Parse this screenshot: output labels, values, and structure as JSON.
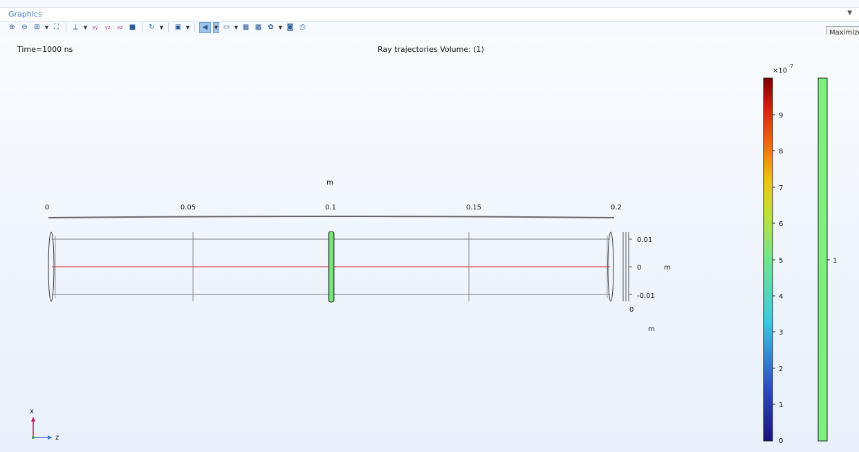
{
  "window": {
    "title": "Graphics",
    "tooltip": "Maximize"
  },
  "toolbar": {
    "icons": [
      "zoom-in-icon",
      "zoom-out-icon",
      "zoom-box-icon",
      "zoom-extents-icon",
      "axis-orientation-icon",
      "xy-view-icon",
      "yz-view-icon",
      "xz-view-icon",
      "camera-view-icon",
      "rotate-icon",
      "render-mode-icon",
      "light-icon",
      "wireframe-icon",
      "grid-icon",
      "transparency-icon",
      "image-snapshot-icon",
      "print-icon"
    ]
  },
  "plot": {
    "time_label": "Time=1000 ns",
    "title": "Ray trajectories  Volume: (1)",
    "top_axis": {
      "unit": "m",
      "ticks": [
        "0",
        "0.05",
        "0.1",
        "0.15",
        "0.2"
      ]
    },
    "side_axis": {
      "unit": "m",
      "ticks": [
        "0.01",
        "0",
        "-0.01"
      ]
    },
    "depth_axis": {
      "tick": "0",
      "unit": "m"
    },
    "axis_triad": {
      "vertical": "x",
      "horizontal": "z"
    }
  },
  "colorbars": {
    "left": {
      "exponent_base": "×10",
      "exponent": "-7",
      "ticks": [
        "9",
        "8",
        "7",
        "6",
        "5",
        "4",
        "3",
        "2",
        "1",
        "0"
      ]
    },
    "right": {
      "ticks": [
        "1"
      ],
      "color": "#7ef07e"
    }
  },
  "colors": {
    "ray": "#d22b2b",
    "lens": "#77e07a",
    "outline": "#333333"
  }
}
